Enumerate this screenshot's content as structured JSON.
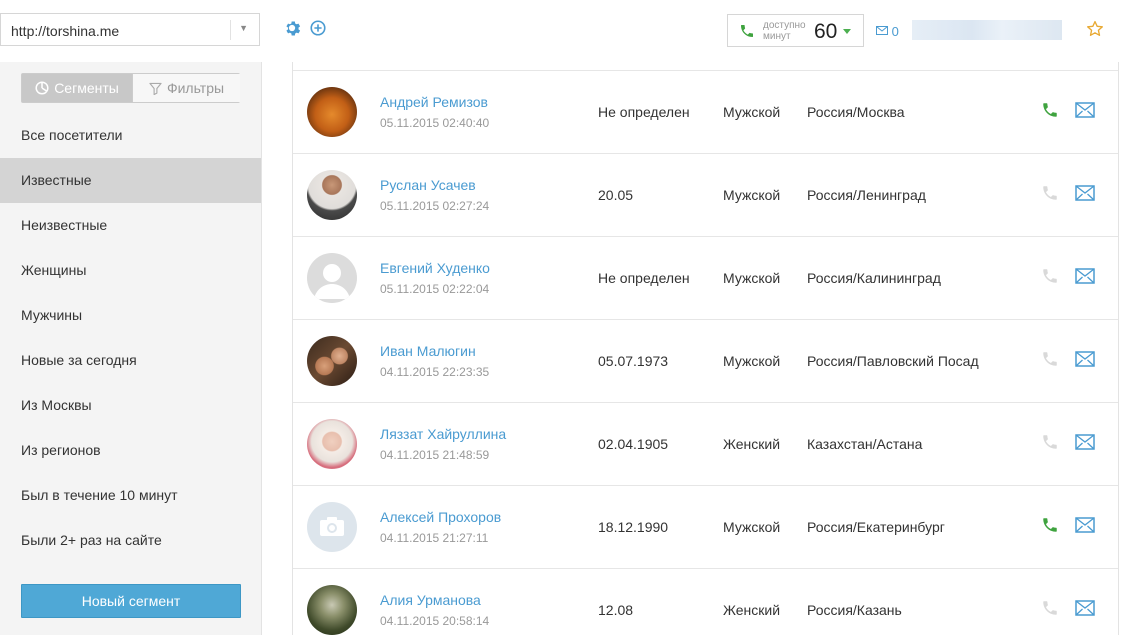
{
  "header": {
    "site_url": "http://torshina.me",
    "minutes_label_1": "доступно",
    "minutes_label_2": "минут",
    "minutes_value": "60",
    "messages_count": "0"
  },
  "sidebar": {
    "toggle": {
      "segments_label": "Сегменты",
      "filters_label": "Фильтры"
    },
    "items": [
      {
        "label": "Все посетители"
      },
      {
        "label": "Известные",
        "active": true
      },
      {
        "label": "Неизвестные"
      },
      {
        "label": "Женщины"
      },
      {
        "label": "Мужчины"
      },
      {
        "label": "Новые за сегодня"
      },
      {
        "label": "Из Москвы"
      },
      {
        "label": "Из регионов"
      },
      {
        "label": "Был в течение 10 минут"
      },
      {
        "label": "Были 2+ раз на сайте"
      }
    ],
    "new_segment_label": "Новый сегмент"
  },
  "visitors": [
    {
      "name": "Андрей Ремизов",
      "datetime": "05.11.2015 02:40:40",
      "birth": "Не определен",
      "gender": "Мужской",
      "location": "Россия/Москва",
      "phone_active": true,
      "avatar": "photo-orange"
    },
    {
      "name": "Руслан Усачев",
      "datetime": "05.11.2015 02:27:24",
      "birth": "20.05",
      "gender": "Мужской",
      "location": "Россия/Ленинград",
      "phone_active": false,
      "avatar": "photo-man"
    },
    {
      "name": "Евгений Худенко",
      "datetime": "05.11.2015 02:22:04",
      "birth": "Не определен",
      "gender": "Мужской",
      "location": "Россия/Калининград",
      "phone_active": false,
      "avatar": "placeholder-person"
    },
    {
      "name": "Иван Малюгин",
      "datetime": "04.11.2015 22:23:35",
      "birth": "05.07.1973",
      "gender": "Мужской",
      "location": "Россия/Павловский Посад",
      "phone_active": false,
      "avatar": "photo-couple"
    },
    {
      "name": "Ляззат Хайруллина",
      "datetime": "04.11.2015 21:48:59",
      "birth": "02.04.1905",
      "gender": "Женский",
      "location": "Казахстан/Астана",
      "phone_active": false,
      "avatar": "photo-woman"
    },
    {
      "name": "Алексей Прохоров",
      "datetime": "04.11.2015 21:27:11",
      "birth": "18.12.1990",
      "gender": "Мужской",
      "location": "Россия/Екатеринбург",
      "phone_active": true,
      "avatar": "placeholder-camera"
    },
    {
      "name": "Алия Урманова",
      "datetime": "04.11.2015 20:58:14",
      "birth": "12.08",
      "gender": "Женский",
      "location": "Россия/Казань",
      "phone_active": false,
      "avatar": "photo-outdoor"
    }
  ],
  "colors": {
    "accent": "#4a9bd1",
    "phone_active": "#3fa33f",
    "phone_inactive": "#d9d9d9",
    "button": "#4fa8d6"
  }
}
